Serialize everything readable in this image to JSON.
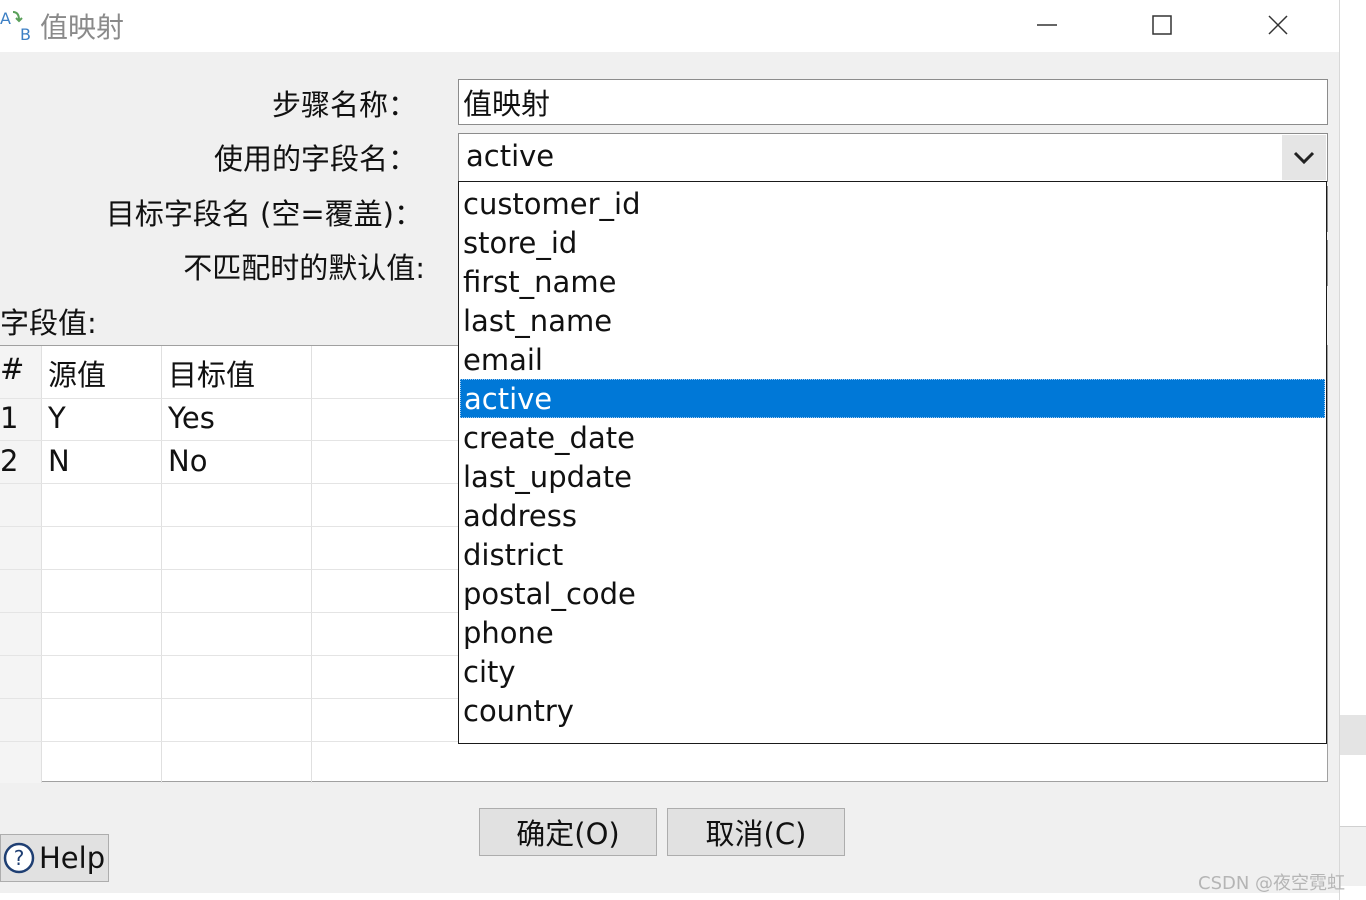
{
  "window": {
    "title": "值映射"
  },
  "labels": {
    "step_name": "步骤名称：",
    "field_name": "使用的字段名：",
    "target_field": "目标字段名 (空=覆盖)：",
    "default_value": "不匹配时的默认值:",
    "field_values": "字段值:"
  },
  "inputs": {
    "step_name_value": "值映射"
  },
  "combo": {
    "selected_value": "active",
    "options": [
      "customer_id",
      "store_id",
      "first_name",
      "last_name",
      "email",
      "active",
      "create_date",
      "last_update",
      "address",
      "district",
      "postal_code",
      "phone",
      "city",
      "country"
    ],
    "selected_index": 5,
    "highlight_color": "#0078d7"
  },
  "table": {
    "headers": [
      "#",
      "源值",
      "目标值"
    ],
    "rows": [
      {
        "idx": "1",
        "src": "Y",
        "tgt": "Yes"
      },
      {
        "idx": "2",
        "src": "N",
        "tgt": "No"
      }
    ]
  },
  "buttons": {
    "ok": "确定(O)",
    "cancel": "取消(C)",
    "help": "Help"
  },
  "watermark": "CSDN @夜空霓虹"
}
